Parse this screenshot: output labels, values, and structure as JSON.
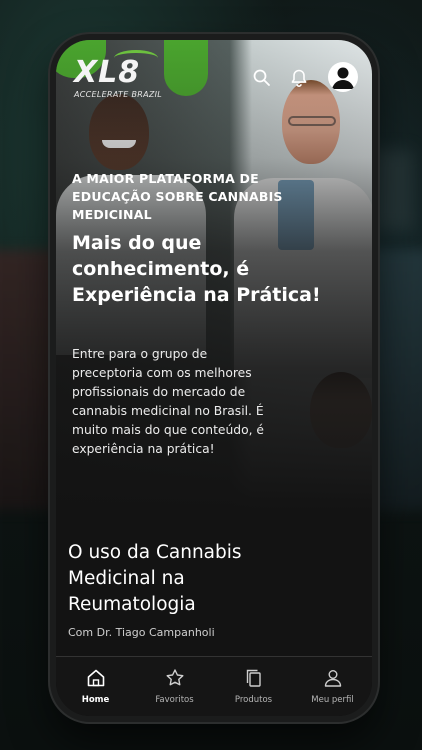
{
  "app": {
    "logo_text": "XL8",
    "logo_subtitle": "ACCELERATE BRAZIL"
  },
  "header": {
    "icons": [
      "search-icon",
      "bell-icon",
      "avatar-icon"
    ]
  },
  "hero": {
    "eyebrow": "A MAIOR PLATAFORMA DE EDUCAÇÃO SOBRE CANNABIS MEDICINAL",
    "headline": "Mais do que conhecimento, é Experiência na Prática!",
    "description": "Entre para o grupo de preceptoria com os melhores profissionais do mercado de cannabis medicinal no Brasil. É muito mais do que conteúdo, é experiência na prática!"
  },
  "course": {
    "title": "O uso da Cannabis Medicinal na Reumatologia",
    "author": "Com Dr. Tiago Campanholi"
  },
  "bottom_nav": {
    "items": [
      {
        "label": "Home",
        "icon": "home-icon",
        "active": true
      },
      {
        "label": "Favoritos",
        "icon": "star-icon",
        "active": false
      },
      {
        "label": "Produtos",
        "icon": "copy-icon",
        "active": false
      },
      {
        "label": "Meu perfil",
        "icon": "person-icon",
        "active": false
      }
    ]
  },
  "colors": {
    "brand_green": "#4aa42e",
    "accent_teal": "#2aa7a4",
    "background": "#131313"
  }
}
